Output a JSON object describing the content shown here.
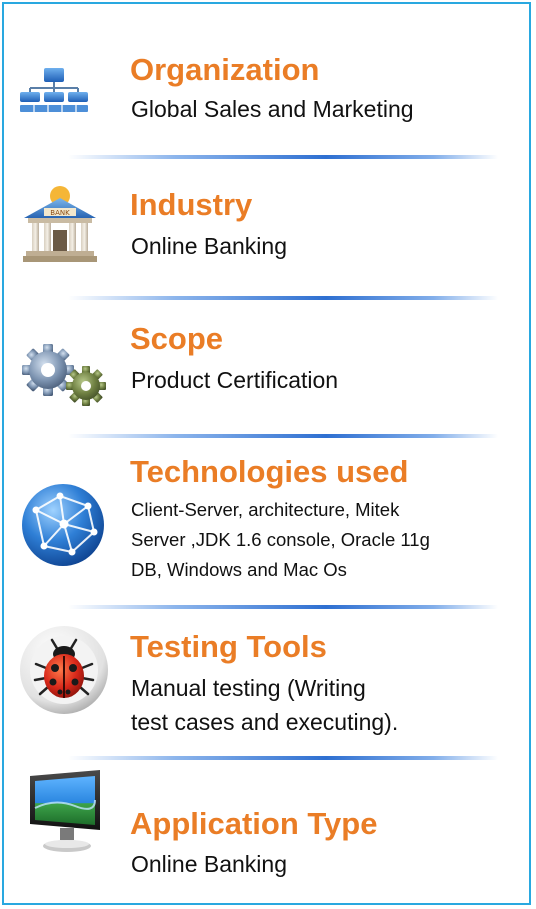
{
  "sections": [
    {
      "title": "Organization",
      "description": [
        "Global Sales and Marketing"
      ],
      "icon": "org-chart-icon"
    },
    {
      "title": "Industry",
      "description": [
        "Online Banking"
      ],
      "icon": "bank-icon",
      "icon_text": "BANK"
    },
    {
      "title": "Scope",
      "description": [
        "Product Certification"
      ],
      "icon": "gears-icon"
    },
    {
      "title": "Technologies used",
      "description": [
        "Client-Server, architecture, Mitek",
        "Server ,JDK 1.6 console, Oracle 11g",
        "DB, Windows and Mac Os"
      ],
      "icon": "globe-network-icon"
    },
    {
      "title": "Testing Tools",
      "description": [
        "Manual testing (Writing",
        "test cases and executing)."
      ],
      "icon": "ladybug-icon"
    },
    {
      "title": "Application Type",
      "description": [
        "Online Banking"
      ],
      "icon": "monitor-icon"
    }
  ],
  "colors": {
    "border": "#29a8e0",
    "title": "#ea7d26",
    "text": "#111111",
    "divider": "#2e6fd1"
  }
}
